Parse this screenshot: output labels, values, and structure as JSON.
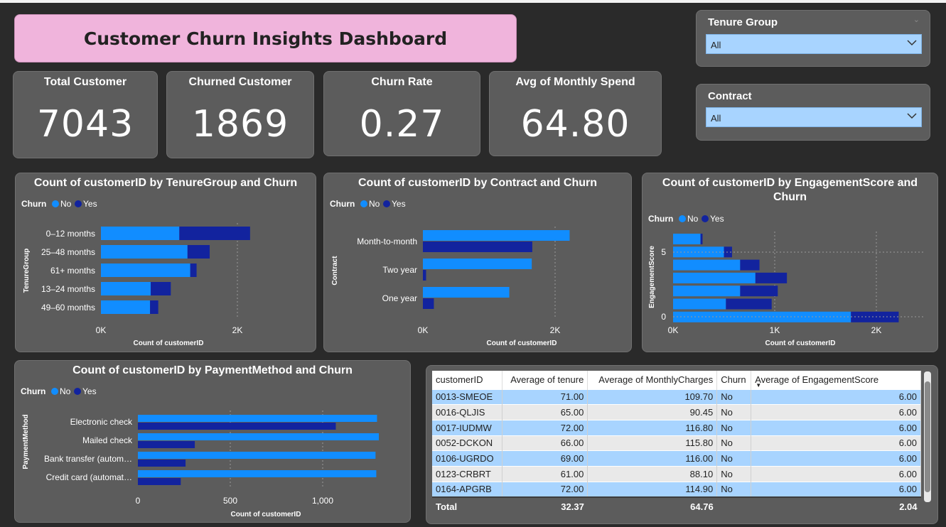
{
  "header": {
    "title": "Customer Churn Insights Dashboard"
  },
  "kpis": [
    {
      "label": "Total Customer",
      "value": "7043"
    },
    {
      "label": "Churned Customer",
      "value": "1869"
    },
    {
      "label": "Churn Rate",
      "value": "0.27"
    },
    {
      "label": "Avg of Monthly Spend",
      "value": "64.80"
    }
  ],
  "slicers": {
    "tenure": {
      "label": "Tenure Group",
      "value": "All"
    },
    "contract": {
      "label": "Contract",
      "value": "All"
    }
  },
  "colors": {
    "no": "#118dff",
    "yes": "#12239e",
    "panel": "#5c5c5c",
    "background": "#2a2a2a",
    "title_bg": "#f0b4dc"
  },
  "legend": {
    "title": "Churn",
    "no": "No",
    "yes": "Yes"
  },
  "charts": {
    "tenure": {
      "title": "Count of customerID by TenureGroup and Churn",
      "xlabel": "Count of customerID",
      "ylabel": "TenureGroup",
      "ticks": [
        "0K",
        "2K"
      ]
    },
    "contract": {
      "title": "Count of customerID by Contract and Churn",
      "xlabel": "Count of customerID",
      "ylabel": "Contract",
      "ticks": [
        "0K",
        "2K"
      ]
    },
    "engagement": {
      "title_line1": "Count of customerID by EngagementScore and",
      "title_line2": "Churn",
      "xlabel": "Count of customerID",
      "ylabel": "EngagementScore",
      "ticks": [
        "0K",
        "1K",
        "2K"
      ],
      "yticks": [
        "5",
        "0"
      ]
    },
    "payment": {
      "title": "Count of customerID by PaymentMethod and Churn",
      "xlabel": "Count of customerID",
      "ylabel": "PaymentMethod",
      "ticks": [
        "0",
        "500",
        "1,000"
      ]
    }
  },
  "chart_data": [
    {
      "type": "bar",
      "orientation": "horizontal",
      "stacked": true,
      "title": "Count of customerID by TenureGroup and Churn",
      "categories": [
        "0–12 months",
        "25–48 months",
        "61+ months",
        "13–24 months",
        "49–60 months"
      ],
      "series": [
        {
          "name": "No",
          "values": [
            1149,
            1269,
            1309,
            730,
            720
          ]
        },
        {
          "name": "Yes",
          "values": [
            1037,
            325,
            93,
            294,
            120
          ]
        }
      ],
      "xlim": [
        0,
        2500
      ]
    },
    {
      "type": "bar",
      "orientation": "horizontal",
      "stacked": false,
      "title": "Count of customerID by Contract and Churn",
      "categories": [
        "Month-to-month",
        "Two year",
        "One year"
      ],
      "series": [
        {
          "name": "No",
          "values": [
            2220,
            1647,
            1307
          ]
        },
        {
          "name": "Yes",
          "values": [
            1655,
            48,
            166
          ]
        }
      ],
      "xlim": [
        0,
        2500
      ]
    },
    {
      "type": "bar",
      "orientation": "horizontal",
      "stacked": true,
      "title": "Count of customerID by EngagementScore and Churn",
      "categories": [
        "6",
        "5",
        "4",
        "3",
        "2",
        "1",
        "0"
      ],
      "series": [
        {
          "name": "No",
          "values": [
            270,
            500,
            660,
            810,
            660,
            520,
            1750
          ]
        },
        {
          "name": "Yes",
          "values": [
            20,
            80,
            190,
            310,
            370,
            450,
            470
          ]
        }
      ],
      "xlim": [
        0,
        2500
      ]
    },
    {
      "type": "bar",
      "orientation": "horizontal",
      "stacked": false,
      "title": "Count of customerID by PaymentMethod and Churn",
      "categories": [
        "Electronic check",
        "Mailed check",
        "Bank transfer (autom…",
        "Credit card (automat…"
      ],
      "series": [
        {
          "name": "No",
          "values": [
            1294,
            1304,
            1286,
            1290
          ]
        },
        {
          "name": "Yes",
          "values": [
            1071,
            308,
            258,
            232
          ]
        }
      ],
      "xlim": [
        0,
        1400
      ]
    }
  ],
  "table": {
    "columns": [
      "customerID",
      "Average of tenure",
      "Average of MonthlyCharges",
      "Churn",
      "Average of EngagementScore"
    ],
    "rows": [
      [
        "0013-SMEOE",
        "71.00",
        "109.70",
        "No",
        "6.00"
      ],
      [
        "0016-QLJIS",
        "65.00",
        "90.45",
        "No",
        "6.00"
      ],
      [
        "0017-IUDMW",
        "72.00",
        "116.80",
        "No",
        "6.00"
      ],
      [
        "0052-DCKON",
        "66.00",
        "115.80",
        "No",
        "6.00"
      ],
      [
        "0106-UGRDO",
        "69.00",
        "116.00",
        "No",
        "6.00"
      ],
      [
        "0123-CRBRT",
        "61.00",
        "88.10",
        "No",
        "6.00"
      ],
      [
        "0164-APGRB",
        "72.00",
        "114.90",
        "No",
        "6.00"
      ]
    ],
    "total": [
      "Total",
      "32.37",
      "64.76",
      "",
      "2.04"
    ]
  }
}
